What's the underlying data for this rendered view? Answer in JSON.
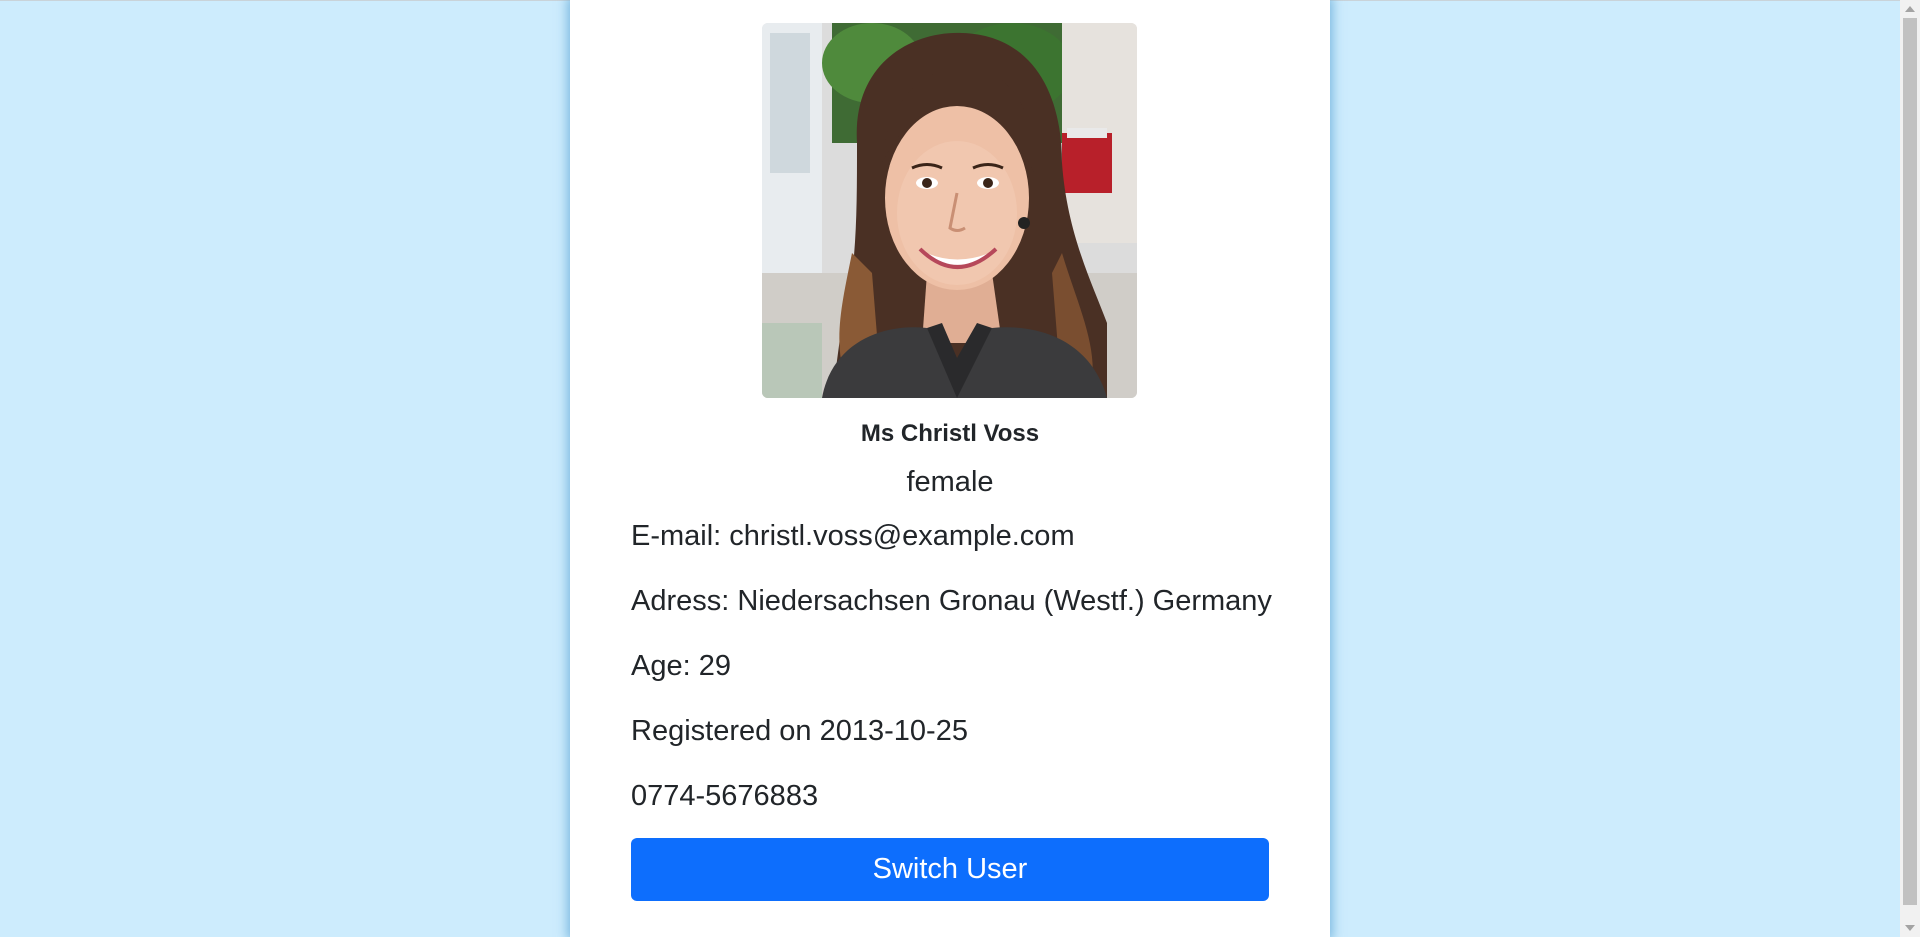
{
  "profile": {
    "name": "Ms Christl Voss",
    "gender": "female",
    "email": "E-mail: christl.voss@example.com",
    "address": "Adress: Niedersachsen Gronau (Westf.) Germany",
    "age": "Age: 29",
    "registered": "Registered on 2013-10-25",
    "phone": "0774-5676883"
  },
  "actions": {
    "switch_user_label": "Switch User"
  },
  "colors": {
    "page_background": "#cdecfd",
    "card_background": "#ffffff",
    "button_primary": "#0d6efd",
    "text": "#212529"
  }
}
